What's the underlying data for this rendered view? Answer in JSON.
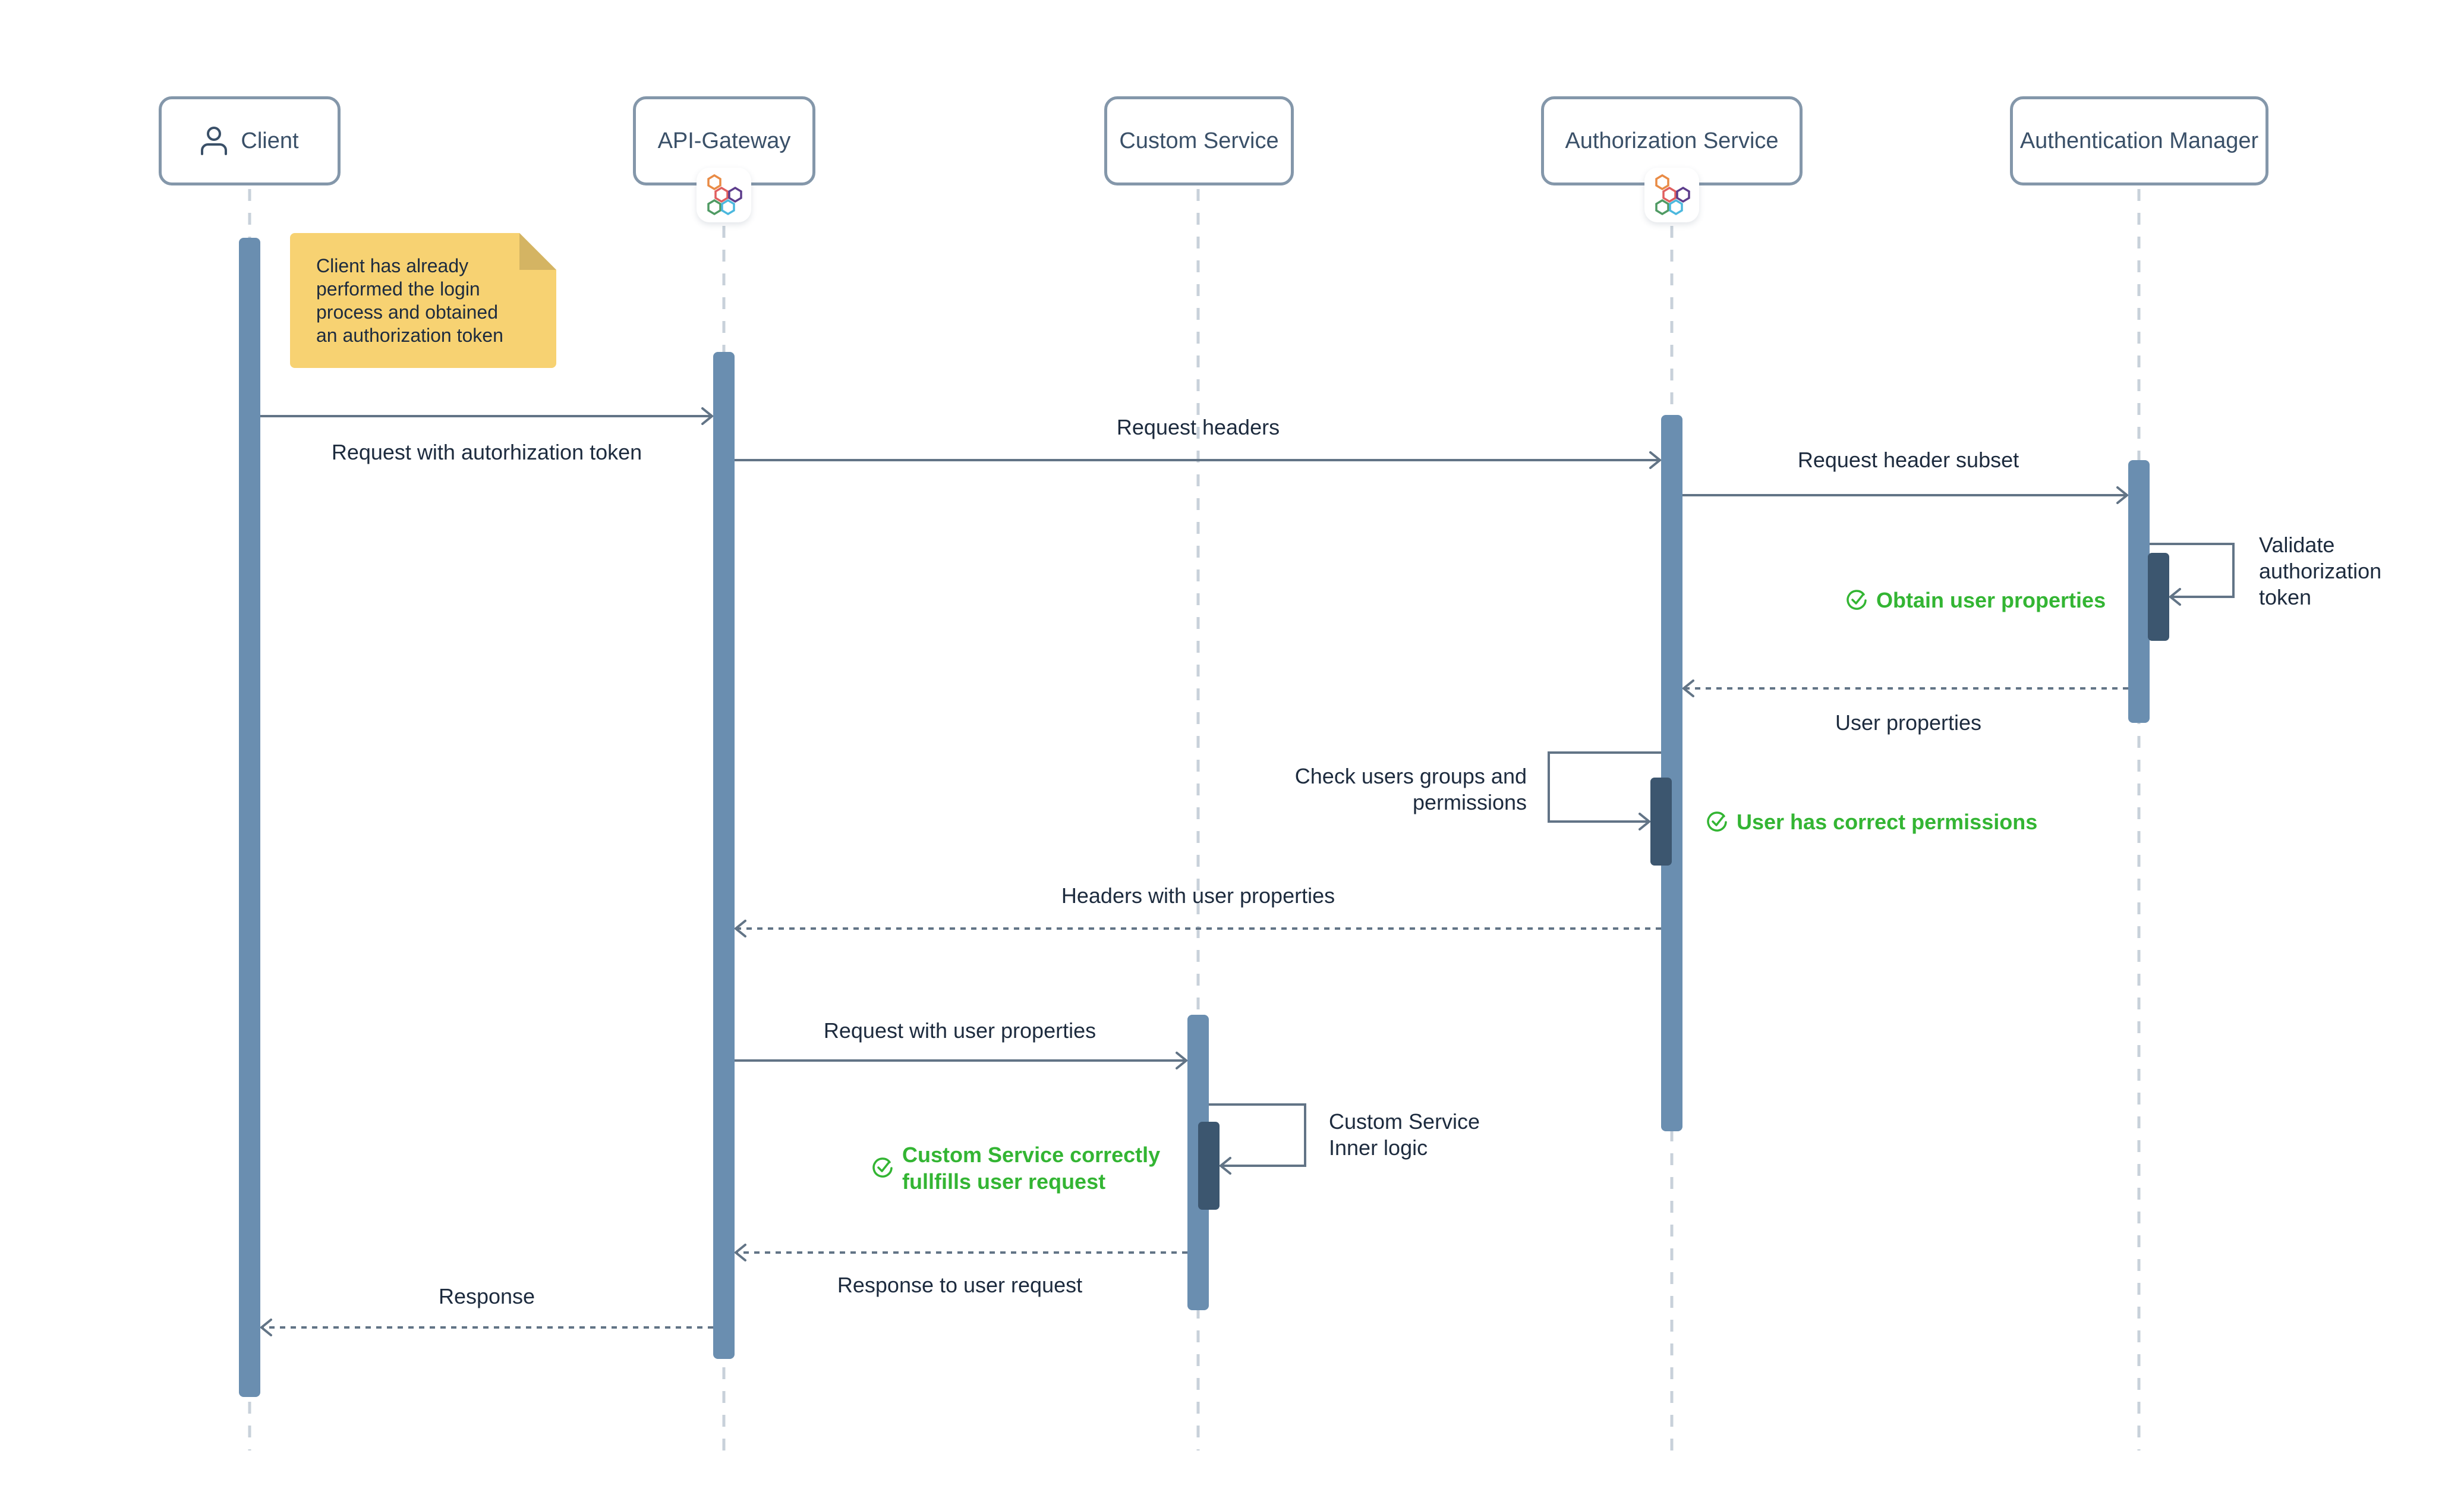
{
  "diagram": {
    "type": "sequence-diagram",
    "participants": [
      {
        "id": "client",
        "label": "Client",
        "icon": "person-icon"
      },
      {
        "id": "api_gateway",
        "label": "API-Gateway",
        "badge": "hexagon-cluster-logo"
      },
      {
        "id": "custom_service",
        "label": "Custom Service"
      },
      {
        "id": "authorization_service",
        "label": "Authorization Service",
        "badge": "hexagon-cluster-logo"
      },
      {
        "id": "authentication_manager",
        "label": "Authentication Manager"
      }
    ],
    "note": {
      "attached_to": "client",
      "lines": [
        "Client has already",
        "performed the login",
        "process and obtained",
        "an authorization token"
      ]
    },
    "messages": [
      {
        "from": "client",
        "to": "api_gateway",
        "label": "Request with autorhization token",
        "style": "solid"
      },
      {
        "from": "api_gateway",
        "to": "authorization_service",
        "label": "Request headers",
        "style": "solid"
      },
      {
        "from": "authorization_service",
        "to": "authentication_manager",
        "label": "Request header subset",
        "style": "solid"
      },
      {
        "from": "authentication_manager",
        "to": "authentication_manager",
        "label_lines": [
          "Validate",
          "authorization",
          "token"
        ],
        "style": "self"
      },
      {
        "from": "authentication_manager",
        "to": "authorization_service",
        "label": "User properties",
        "style": "dashed"
      },
      {
        "from": "authorization_service",
        "to": "authorization_service",
        "label_lines": [
          "Check users groups and",
          "permissions"
        ],
        "style": "self"
      },
      {
        "from": "authorization_service",
        "to": "api_gateway",
        "label": "Headers with user properties",
        "style": "dashed"
      },
      {
        "from": "api_gateway",
        "to": "custom_service",
        "label": "Request with user properties",
        "style": "solid"
      },
      {
        "from": "custom_service",
        "to": "custom_service",
        "label_lines": [
          "Custom Service",
          "Inner logic"
        ],
        "style": "self"
      },
      {
        "from": "custom_service",
        "to": "api_gateway",
        "label": "Response to user request",
        "style": "dashed"
      },
      {
        "from": "api_gateway",
        "to": "client",
        "label": "Response",
        "style": "dashed"
      }
    ],
    "outcomes": [
      {
        "on": "authentication_manager",
        "lines": [
          "Obtain user properties"
        ],
        "icon": "check-circle-icon"
      },
      {
        "on": "authorization_service",
        "lines": [
          "User has correct permissions"
        ],
        "icon": "check-circle-icon"
      },
      {
        "on": "custom_service",
        "lines": [
          "Custom Service correctly",
          "fullfills user request"
        ],
        "icon": "check-circle-icon"
      }
    ],
    "colors": {
      "participant_border": "#8497aa",
      "participant_text": "#3a5068",
      "activation": "#6a8eb0",
      "nested_activation": "#3c566f",
      "arrow": "#627486",
      "lifeline": "#c8d1da",
      "note_fill": "#f7d272",
      "note_fold": "#d4b463",
      "success": "#33b533",
      "text": "#1d2b3e"
    }
  }
}
